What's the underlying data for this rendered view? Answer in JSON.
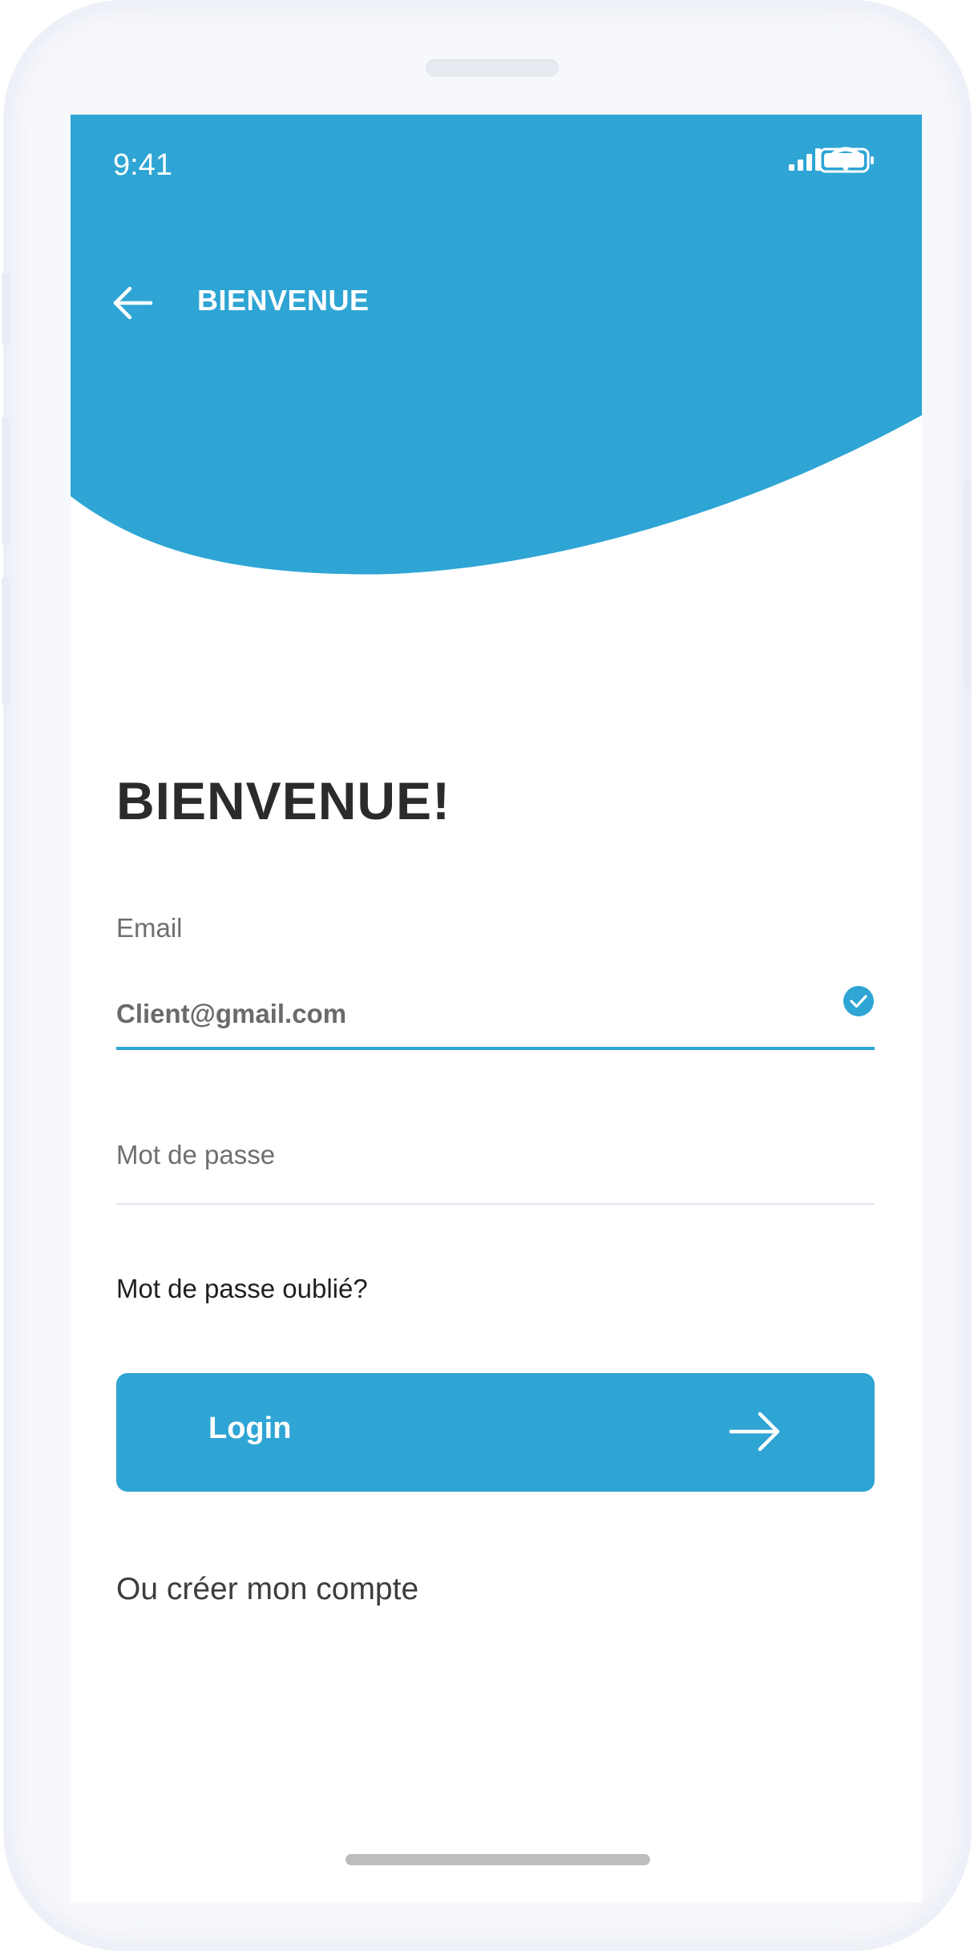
{
  "status_bar": {
    "time": "9:41",
    "icons": [
      "signal-icon",
      "wifi-icon",
      "battery-icon"
    ]
  },
  "header": {
    "back_icon": "arrow-left-icon",
    "title": "BIENVENUE"
  },
  "main": {
    "welcome_heading": "BIENVENUE!",
    "email": {
      "label": "Email",
      "value": "Client@gmail.com",
      "status_icon": "check-circle-icon"
    },
    "password": {
      "placeholder": "Mot de passe",
      "value": ""
    },
    "forgot_password_link": "Mot de passe oublié?",
    "login_button": {
      "label": "Login",
      "icon": "arrow-right-icon"
    },
    "create_account_link": "Ou créer mon compte"
  },
  "colors": {
    "primary": "#2ea5d4",
    "heading_text": "#2b2b2b",
    "muted_text": "#6f6f6f",
    "background": "#ffffff"
  }
}
